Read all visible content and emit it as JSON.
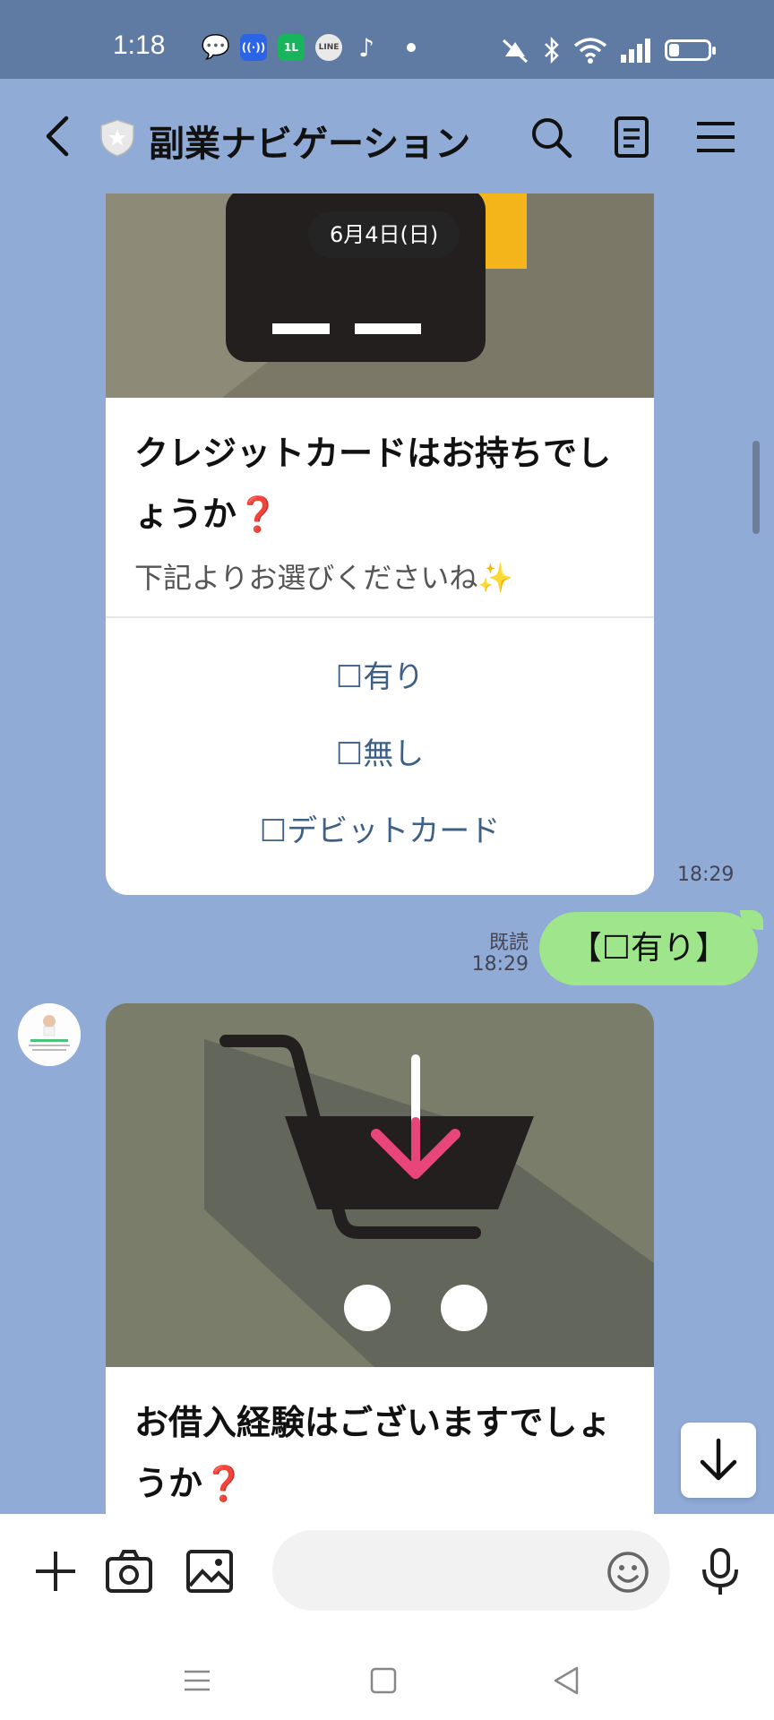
{
  "status_bar": {
    "time": "1:18",
    "notification_icons": [
      "chat-bubble-icon",
      "broadcast-icon",
      "app-icon",
      "line-icon",
      "tiktok-icon"
    ],
    "line_icon_text": "LINE",
    "battery_percent": 25
  },
  "header": {
    "title": "副業ナビゲーション"
  },
  "messages": {
    "date_label": "6月4日(日)",
    "card1": {
      "title_line1": "クレジットカードはお持ちでし",
      "title_line2": "ょうか❓",
      "subtitle": "下記よりお選びくださいね✨",
      "options": [
        "☐有り",
        "☐無し",
        "☐デビットカード"
      ],
      "time": "18:29"
    },
    "my_reply": {
      "text": "【☐有り】",
      "read_label": "既読",
      "time": "18:29"
    },
    "card2": {
      "title_line1": "お借入経験はございますでしょ",
      "title_line2": "うか❓"
    }
  },
  "input_bar": {
    "placeholder": ""
  },
  "colors": {
    "chat_background": "#8fabd6",
    "status_bar": "#5f7aa3",
    "my_bubble": "#9fe58c",
    "option_text": "#3e5f86"
  }
}
